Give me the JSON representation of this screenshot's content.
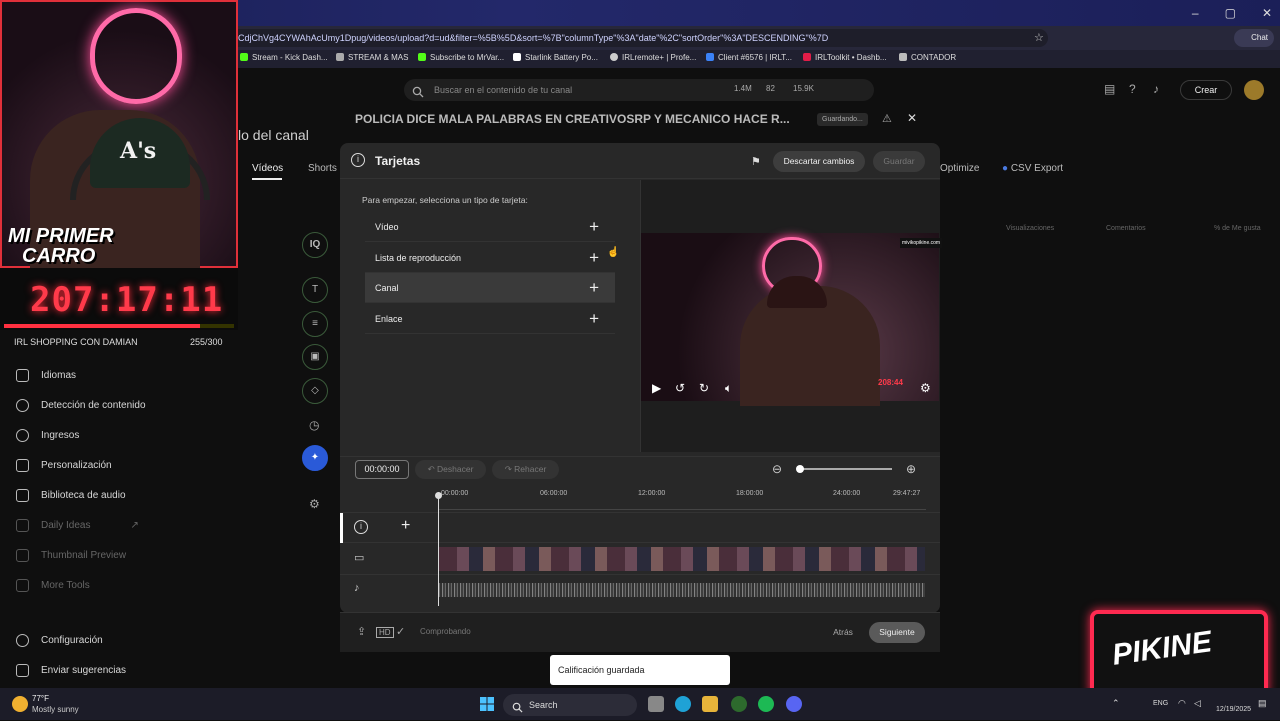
{
  "browser": {
    "url": "CdjChVg4CYWAhAcUmy1Dpug/videos/upload?d=ud&filter=%5B%5D&sort=%7B\"columnType\"%3A\"date\"%2C\"sortOrder\"%3A\"DESCENDING\"%7D",
    "chat_label": "Chat",
    "bookmarks": [
      {
        "label": "Stream - Kick Dash...",
        "color": "#53fc18"
      },
      {
        "label": "STREAM & MAS",
        "color": "#aaaaaa"
      },
      {
        "label": "Subscribe to MrVar...",
        "color": "#53fc18"
      },
      {
        "label": "Starlink Battery Po...",
        "color": "#ffffff"
      },
      {
        "label": "IRLremote+ | Profe...",
        "color": "#cccccc"
      },
      {
        "label": "Client #6576 | IRLT...",
        "color": "#3b82f6"
      },
      {
        "label": "IRLToolkit • Dashb...",
        "color": "#e11d48"
      },
      {
        "label": "CONTADOR",
        "color": "#bbbbbb"
      }
    ]
  },
  "studio": {
    "search_placeholder": "Buscar en el contenido de tu canal",
    "stats": [
      "1.4M",
      "82",
      "15.9K"
    ],
    "create_label": "Crear",
    "page_title": "lo del canal",
    "tabs": [
      "Vídeos",
      "Shorts",
      "Optimize",
      "CSV Export"
    ],
    "columns": [
      "Visualizaciones",
      "Comentarios",
      "% de Me gusta"
    ]
  },
  "nav": {
    "items": [
      {
        "label": "Idiomas",
        "dim": false
      },
      {
        "label": "Detección de contenido",
        "dim": false
      },
      {
        "label": "Ingresos",
        "dim": false
      },
      {
        "label": "Personalización",
        "dim": false
      },
      {
        "label": "Biblioteca de audio",
        "dim": false
      },
      {
        "label": "Daily Ideas",
        "dim": true
      },
      {
        "label": "Thumbnail Preview",
        "dim": true
      },
      {
        "label": "More Tools",
        "dim": true
      },
      {
        "label": "Configuración",
        "dim": false
      },
      {
        "label": "Enviar sugerencias",
        "dim": false
      }
    ]
  },
  "overlay": {
    "cap_logo": "A's",
    "car_text_1": "MI PRIMER",
    "car_text_2": "CARRO",
    "timer": "207:17:11",
    "goal_label": "IRL SHOPPING CON DAMIAN",
    "goal_count": "255/300",
    "goal_fraction": 0.85
  },
  "video": {
    "title": "POLICIA DICE MALA PALABRAS EN CREATIVOSRP Y MECANICO HACE R...",
    "status": "Guardando..."
  },
  "dialog": {
    "title": "Tarjetas",
    "discard_label": "Descartar cambios",
    "save_label": "Guardar",
    "instructions": "Para empezar, selecciona un tipo de tarjeta:",
    "card_types": [
      {
        "label": "Vídeo",
        "active": false
      },
      {
        "label": "Lista de reproducción",
        "active": false
      },
      {
        "label": "Canal",
        "active": true
      },
      {
        "label": "Enlace",
        "active": false
      }
    ],
    "preview": {
      "url": "mivikopikine.com",
      "timer": "208:44"
    },
    "timeline": {
      "time": "00:00:00",
      "undo_label": "Deshacer",
      "redo_label": "Rehacer",
      "ticks": [
        "00:00:00",
        "06:00:00",
        "12:00:00",
        "18:00:00",
        "24:00:00",
        "29:47:27"
      ]
    },
    "footer": {
      "checking": "Comprobando",
      "back_label": "Atrás",
      "next_label": "Siguiente"
    }
  },
  "toast": "Calificación guardada",
  "pikine": "PIKINE",
  "taskbar": {
    "temp": "77°F",
    "weather": "Mostly sunny",
    "search": "Search",
    "lang": "ENG",
    "date": "12/19/2025"
  }
}
